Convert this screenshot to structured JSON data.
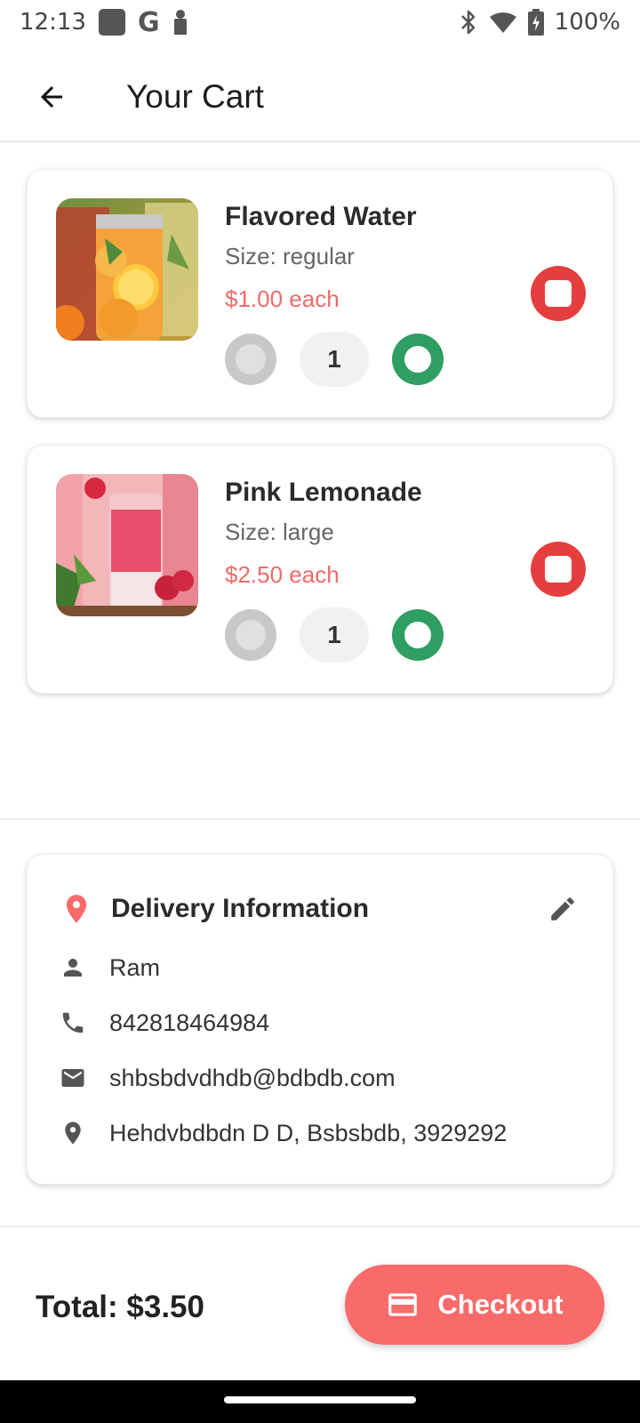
{
  "status_bar": {
    "time": "12:13",
    "battery": "100%",
    "icons": [
      "square-notification-icon",
      "google-icon",
      "keyhole-icon",
      "bluetooth-icon",
      "wifi-icon",
      "battery-charging-icon"
    ]
  },
  "app_bar": {
    "title": "Your Cart",
    "back_icon": "arrow-back-icon"
  },
  "cart_items": [
    {
      "name": "Flavored Water",
      "size": "Size: regular",
      "price": "$1.00 each",
      "quantity": "1"
    },
    {
      "name": "Pink Lemonade",
      "size": "Size: large",
      "price": "$2.50 each",
      "quantity": "1"
    }
  ],
  "delivery": {
    "title": "Delivery Information",
    "name": "Ram",
    "phone": "842818464984",
    "email": "shbsbdvdhdb@bdbdb.com",
    "address": "Hehdvbdbdn D D, Bsbsbdb, 3929292"
  },
  "footer": {
    "total": "Total: $3.50",
    "checkout_label": "Checkout"
  },
  "colors": {
    "accent": "#f96a6a",
    "price": "#f06a6a",
    "remove": "#e53e3e",
    "increment": "#2f9e62"
  }
}
